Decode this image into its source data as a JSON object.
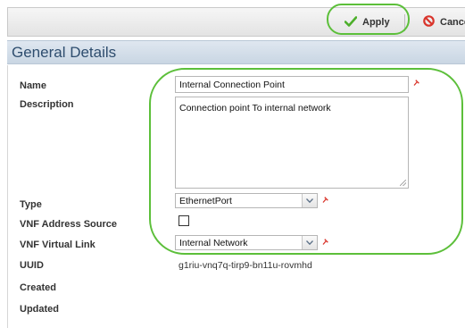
{
  "toolbar": {
    "apply_label": "Apply",
    "cancel_label": "Cancel"
  },
  "section": {
    "title": "General Details"
  },
  "form": {
    "name": {
      "label": "Name",
      "value": "Internal Connection Point"
    },
    "description": {
      "label": "Description",
      "value": "Connection point To internal network"
    },
    "type": {
      "label": "Type",
      "value": "EthernetPort"
    },
    "vnf_address_source": {
      "label": "VNF Address Source",
      "checked": false
    },
    "vnf_virtual_link": {
      "label": "VNF Virtual Link",
      "value": "Internal Network"
    },
    "uuid": {
      "label": "UUID",
      "value": "g1riu-vnq7q-tirp9-bn11u-rovmhd"
    },
    "created": {
      "label": "Created"
    },
    "updated": {
      "label": "Updated"
    }
  },
  "colors": {
    "section_title": "#2e4d6e",
    "apply_check": "#4caf2a",
    "cancel_icon": "#d9342b",
    "required_pin": "#d9342b",
    "annotation": "#5cbf3a"
  },
  "icons": {
    "apply": "checkmark-icon",
    "cancel": "cancel-icon",
    "required": "required-pin-icon",
    "dropdown": "chevron-down-icon"
  }
}
